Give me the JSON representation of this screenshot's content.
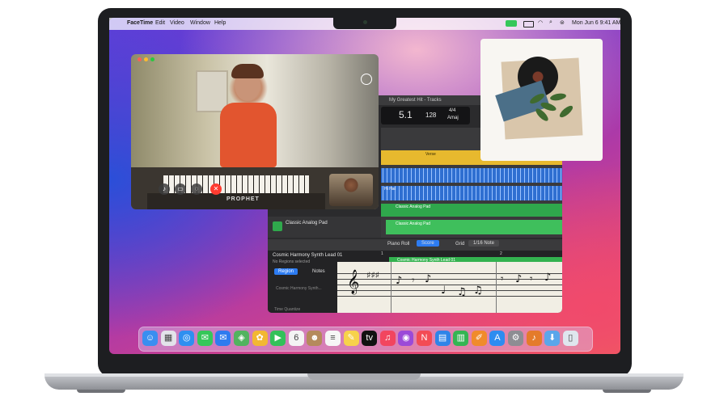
{
  "menubar": {
    "app_name": "FaceTime",
    "menus": [
      "Edit",
      "Video",
      "Window",
      "Help"
    ],
    "clock": "Mon Jun 6  9:41 AM"
  },
  "logic": {
    "window_title": "My Greatest Hit - Tracks",
    "position": "5.1",
    "tempo": "128",
    "time_signature": "4/4",
    "key": "Amaj",
    "region_verse_label": "Verse",
    "region_verse2_label": "Verse",
    "hihat_label": "Hi Hat",
    "pad_track_name": "Classic Analog Pad",
    "pad_region_label": "Classic Analog Pad",
    "lead_track_name": "Cosmic Harmony Synth Lead 01",
    "lead_subtitle": "No Regions selected",
    "region_tab": "Region",
    "notes_tab": "Notes",
    "inspector_region": "Cosmic Harmony Synth...",
    "time_quantize": "Time Quantize",
    "piano_roll_tab": "Piano Roll",
    "score_tab": "Score",
    "grid_label": "Grid",
    "grid_value": "1/16 Note",
    "bar_1": "1",
    "bar_2": "2",
    "score_region_label": "Cosmic Harmony Synth Lead 01"
  },
  "facetime": {
    "brand_text": "PROPHET"
  },
  "dock": {
    "icons": [
      {
        "name": "finder-icon",
        "glyph": "☺",
        "color": "#3a8ef0"
      },
      {
        "name": "launchpad-icon",
        "glyph": "▦",
        "color": "#e3e3ea"
      },
      {
        "name": "safari-icon",
        "glyph": "◎",
        "color": "#2f8ff0"
      },
      {
        "name": "messages-icon",
        "glyph": "✉",
        "color": "#35c759"
      },
      {
        "name": "mail-icon",
        "glyph": "✉",
        "color": "#2f7bef"
      },
      {
        "name": "maps-icon",
        "glyph": "◈",
        "color": "#52b35f"
      },
      {
        "name": "photos-icon",
        "glyph": "✿",
        "color": "#f2b733"
      },
      {
        "name": "facetime-icon",
        "glyph": "▶",
        "color": "#33c15a"
      },
      {
        "name": "calendar-icon",
        "glyph": "6",
        "color": "#f4f4f4"
      },
      {
        "name": "contacts-icon",
        "glyph": "☻",
        "color": "#b58a5c"
      },
      {
        "name": "reminders-icon",
        "glyph": "≡",
        "color": "#f6f6f6"
      },
      {
        "name": "notes-icon",
        "glyph": "✎",
        "color": "#f7d24b"
      },
      {
        "name": "tv-icon",
        "glyph": "tv",
        "color": "#111111"
      },
      {
        "name": "music-icon",
        "glyph": "♫",
        "color": "#f2455f"
      },
      {
        "name": "podcasts-icon",
        "glyph": "◉",
        "color": "#9b4ad8"
      },
      {
        "name": "news-icon",
        "glyph": "N",
        "color": "#f34b55"
      },
      {
        "name": "keynote-icon",
        "glyph": "▤",
        "color": "#2f84e8"
      },
      {
        "name": "numbers-icon",
        "glyph": "▥",
        "color": "#35b553"
      },
      {
        "name": "pages-icon",
        "glyph": "✐",
        "color": "#f08b2b"
      },
      {
        "name": "app-store-icon",
        "glyph": "A",
        "color": "#2e8cf0"
      },
      {
        "name": "system-preferences-icon",
        "glyph": "⚙",
        "color": "#8d8d93"
      },
      {
        "name": "garageband-icon",
        "glyph": "♪",
        "color": "#e47b2b"
      },
      {
        "name": "downloads-icon",
        "glyph": "⬇",
        "color": "#5aa6ea"
      },
      {
        "name": "trash-icon",
        "glyph": "▯",
        "color": "#dfe6ee"
      }
    ]
  }
}
